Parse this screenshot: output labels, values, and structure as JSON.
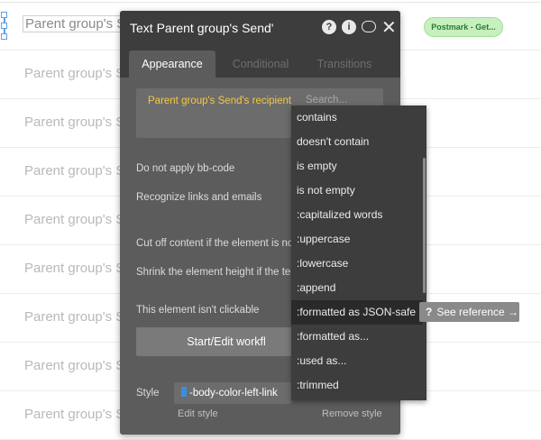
{
  "canvas": {
    "rows": [
      "Parent group's S",
      "Parent group's S",
      "Parent group's S",
      "Parent group's S",
      "Parent group's S",
      "Parent group's S",
      "Parent group's S",
      "Parent group's S",
      "Parent group's S"
    ],
    "badge": "Postmark - Get..."
  },
  "panel": {
    "title": "Text Parent group's Send'",
    "help_icon": "?",
    "info_icon": "i",
    "close_icon": "✕",
    "tabs": [
      "Appearance",
      "Conditional",
      "Transitions"
    ],
    "expression": "Parent group's Send's recipient",
    "search_placeholder": "Search...",
    "labels": {
      "no_bbcode": "Do not apply bb-code",
      "links": "Recognize links and emails",
      "cutoff": "Cut off content if the element is no",
      "shrink": "Shrink the element height if the te",
      "clickable": "This element isn't clickable"
    },
    "workflow_button": "Start/Edit workfl",
    "style_label": "Style",
    "style_value": "-body-color-left-link",
    "edit_style": "Edit style",
    "remove_style": "Remove style"
  },
  "dropdown": {
    "items": [
      "contains",
      "doesn't contain",
      "is empty",
      "is not empty",
      ":capitalized words",
      ":uppercase",
      ":lowercase",
      ":append",
      ":formatted as JSON-safe",
      ":formatted as...",
      ":used as...",
      ":trimmed"
    ],
    "active_index": 8,
    "see_reference": "See reference →",
    "see_reference_icon": "?"
  },
  "colors": {
    "panel_bg": "#5c5c5c",
    "header_bg": "#3d3d3d",
    "expression": "#f5c842",
    "badge_bg": "#c7f0bf"
  }
}
